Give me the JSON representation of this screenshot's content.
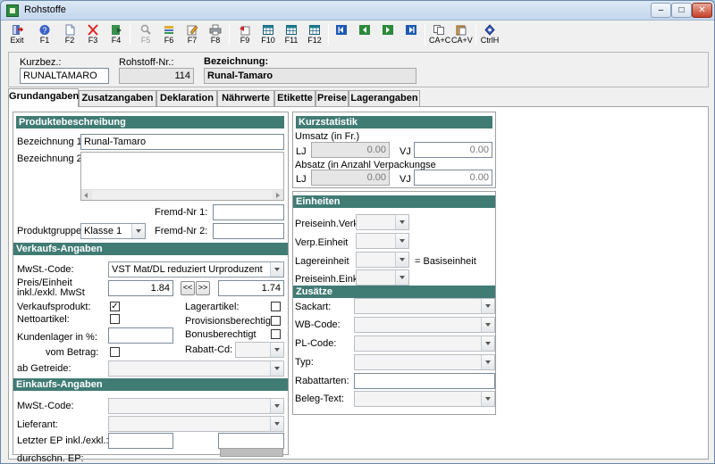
{
  "window": {
    "title": "Rohstoffe"
  },
  "toolbar": [
    {
      "label": "Exit",
      "icon": "exit-icon"
    },
    {
      "label": "F1",
      "icon": "help-icon"
    },
    {
      "label": "F2",
      "icon": "new-document-icon"
    },
    {
      "label": "F3",
      "icon": "delete-icon"
    },
    {
      "label": "F4",
      "icon": "save-icon"
    },
    {
      "label": "F5",
      "icon": "search-icon"
    },
    {
      "label": "F6",
      "icon": "list-icon"
    },
    {
      "label": "F7",
      "icon": "edit-icon"
    },
    {
      "label": "F8",
      "icon": "print-icon"
    },
    {
      "label": "F9",
      "icon": "export-icon"
    },
    {
      "label": "F10",
      "icon": "table-icon"
    },
    {
      "label": "F11",
      "icon": "table-icon"
    },
    {
      "label": "F12",
      "icon": "table-icon"
    },
    {
      "label": "",
      "icon": "first-record-icon"
    },
    {
      "label": "",
      "icon": "previous-record-icon"
    },
    {
      "label": "",
      "icon": "next-record-icon"
    },
    {
      "label": "",
      "icon": "last-record-icon"
    },
    {
      "label": "CA+C",
      "icon": "copy-icon"
    },
    {
      "label": "CA+V",
      "icon": "paste-icon"
    },
    {
      "label": "CtrlH",
      "icon": "history-icon"
    }
  ],
  "header": {
    "kurzbez_label": "Kurzbez.:",
    "kurzbez_value": "RUNALTAMARO",
    "rohstoff_nr_label": "Rohstoff-Nr.:",
    "rohstoff_nr_value": "114",
    "bezeichnung_label": "Bezeichnung:",
    "bezeichnung_value": "Runal-Tamaro"
  },
  "tabs": [
    "Grundangaben",
    "Zusatzangaben",
    "Deklaration",
    "Nährwerte",
    "Etikette",
    "Preise",
    "Lagerangaben"
  ],
  "produkt": {
    "title": "Produktebeschreibung",
    "bez1_label": "Bezeichnung 1:",
    "bez1_value": "Runal-Tamaro",
    "bez2_label": "Bezeichnung 2:",
    "fremd1_label": "Fremd-Nr 1:",
    "fremd2_label": "Fremd-Nr 2:",
    "gruppe_label": "Produktgruppe:",
    "gruppe_value": "Klasse 1"
  },
  "verkauf": {
    "title": "Verkaufs-Angaben",
    "mwst_label": "MwSt.-Code:",
    "mwst_value": "VST Mat/DL reduziert Urproduzent",
    "preis_label": "Preis/Einheit inkl./exkl. MwSt",
    "preis_inkl": "1.84",
    "preis_exkl": "1.74",
    "btn_left": "<<",
    "btn_right": ">>",
    "verkaufsprodukt_label": "Verkaufsprodukt:",
    "verkaufsprodukt_checked": "✓",
    "netto_label": "Nettoartikel:",
    "kundenlager_label": "Kundenlager in %:",
    "vom_betrag_label": "vom Betrag:",
    "ab_getreide_label": "ab Getreide:",
    "lagerartikel_label": "Lagerartikel:",
    "provision_label": "Provisionsberechtigt:",
    "bonus_label": "Bonusberechtigt",
    "rabatt_label": "Rabatt-Cd:"
  },
  "einkauf": {
    "title": "Einkaufs-Angaben",
    "mwst_label": "MwSt.-Code:",
    "lieferant_label": "Lieferant:",
    "letzter_ep_label": "Letzter EP inkl./exkl.:",
    "durchschn_label": "durchschn. EP:"
  },
  "kurzstatistik": {
    "title": "Kurzstatistik",
    "umsatz_label": "Umsatz (in Fr.)",
    "lj": "LJ",
    "vj": "VJ",
    "umsatz_lj": "0.00",
    "umsatz_vj": "0.00",
    "absatz_label": "Absatz (in Anzahl Verpackungse",
    "absatz_lj": "0.00",
    "absatz_vj": "0.00"
  },
  "einheiten": {
    "title": "Einheiten",
    "preiseinh_verk_label": "Preiseinh.Verk.",
    "verp_label": "Verp.Einheit",
    "lager_label": "Lagereinheit",
    "basis_label": "= Basiseinheit",
    "preiseinh_eink_label": "Preiseinh.Eink."
  },
  "zusaetze": {
    "title": "Zusätze",
    "sackart_label": "Sackart:",
    "wb_label": "WB-Code:",
    "pl_label": "PL-Code:",
    "typ_label": "Typ:",
    "rabattarten_label": "Rabattarten:",
    "beleg_label": "Beleg-Text:"
  },
  "colors": {
    "group_header": "#407b74",
    "window_frame": "#a9c3de"
  }
}
